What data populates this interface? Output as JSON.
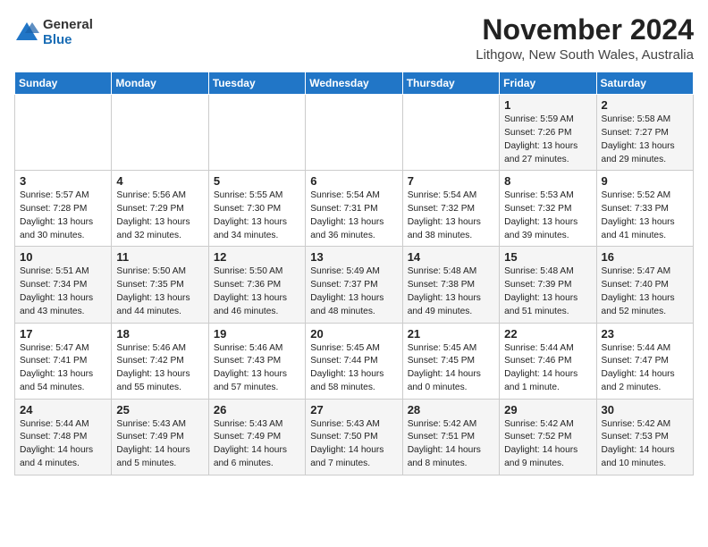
{
  "logo": {
    "general": "General",
    "blue": "Blue"
  },
  "title": "November 2024",
  "location": "Lithgow, New South Wales, Australia",
  "days_of_week": [
    "Sunday",
    "Monday",
    "Tuesday",
    "Wednesday",
    "Thursday",
    "Friday",
    "Saturday"
  ],
  "weeks": [
    [
      {
        "day": "",
        "info": ""
      },
      {
        "day": "",
        "info": ""
      },
      {
        "day": "",
        "info": ""
      },
      {
        "day": "",
        "info": ""
      },
      {
        "day": "",
        "info": ""
      },
      {
        "day": "1",
        "info": "Sunrise: 5:59 AM\nSunset: 7:26 PM\nDaylight: 13 hours\nand 27 minutes."
      },
      {
        "day": "2",
        "info": "Sunrise: 5:58 AM\nSunset: 7:27 PM\nDaylight: 13 hours\nand 29 minutes."
      }
    ],
    [
      {
        "day": "3",
        "info": "Sunrise: 5:57 AM\nSunset: 7:28 PM\nDaylight: 13 hours\nand 30 minutes."
      },
      {
        "day": "4",
        "info": "Sunrise: 5:56 AM\nSunset: 7:29 PM\nDaylight: 13 hours\nand 32 minutes."
      },
      {
        "day": "5",
        "info": "Sunrise: 5:55 AM\nSunset: 7:30 PM\nDaylight: 13 hours\nand 34 minutes."
      },
      {
        "day": "6",
        "info": "Sunrise: 5:54 AM\nSunset: 7:31 PM\nDaylight: 13 hours\nand 36 minutes."
      },
      {
        "day": "7",
        "info": "Sunrise: 5:54 AM\nSunset: 7:32 PM\nDaylight: 13 hours\nand 38 minutes."
      },
      {
        "day": "8",
        "info": "Sunrise: 5:53 AM\nSunset: 7:32 PM\nDaylight: 13 hours\nand 39 minutes."
      },
      {
        "day": "9",
        "info": "Sunrise: 5:52 AM\nSunset: 7:33 PM\nDaylight: 13 hours\nand 41 minutes."
      }
    ],
    [
      {
        "day": "10",
        "info": "Sunrise: 5:51 AM\nSunset: 7:34 PM\nDaylight: 13 hours\nand 43 minutes."
      },
      {
        "day": "11",
        "info": "Sunrise: 5:50 AM\nSunset: 7:35 PM\nDaylight: 13 hours\nand 44 minutes."
      },
      {
        "day": "12",
        "info": "Sunrise: 5:50 AM\nSunset: 7:36 PM\nDaylight: 13 hours\nand 46 minutes."
      },
      {
        "day": "13",
        "info": "Sunrise: 5:49 AM\nSunset: 7:37 PM\nDaylight: 13 hours\nand 48 minutes."
      },
      {
        "day": "14",
        "info": "Sunrise: 5:48 AM\nSunset: 7:38 PM\nDaylight: 13 hours\nand 49 minutes."
      },
      {
        "day": "15",
        "info": "Sunrise: 5:48 AM\nSunset: 7:39 PM\nDaylight: 13 hours\nand 51 minutes."
      },
      {
        "day": "16",
        "info": "Sunrise: 5:47 AM\nSunset: 7:40 PM\nDaylight: 13 hours\nand 52 minutes."
      }
    ],
    [
      {
        "day": "17",
        "info": "Sunrise: 5:47 AM\nSunset: 7:41 PM\nDaylight: 13 hours\nand 54 minutes."
      },
      {
        "day": "18",
        "info": "Sunrise: 5:46 AM\nSunset: 7:42 PM\nDaylight: 13 hours\nand 55 minutes."
      },
      {
        "day": "19",
        "info": "Sunrise: 5:46 AM\nSunset: 7:43 PM\nDaylight: 13 hours\nand 57 minutes."
      },
      {
        "day": "20",
        "info": "Sunrise: 5:45 AM\nSunset: 7:44 PM\nDaylight: 13 hours\nand 58 minutes."
      },
      {
        "day": "21",
        "info": "Sunrise: 5:45 AM\nSunset: 7:45 PM\nDaylight: 14 hours\nand 0 minutes."
      },
      {
        "day": "22",
        "info": "Sunrise: 5:44 AM\nSunset: 7:46 PM\nDaylight: 14 hours\nand 1 minute."
      },
      {
        "day": "23",
        "info": "Sunrise: 5:44 AM\nSunset: 7:47 PM\nDaylight: 14 hours\nand 2 minutes."
      }
    ],
    [
      {
        "day": "24",
        "info": "Sunrise: 5:44 AM\nSunset: 7:48 PM\nDaylight: 14 hours\nand 4 minutes."
      },
      {
        "day": "25",
        "info": "Sunrise: 5:43 AM\nSunset: 7:49 PM\nDaylight: 14 hours\nand 5 minutes."
      },
      {
        "day": "26",
        "info": "Sunrise: 5:43 AM\nSunset: 7:49 PM\nDaylight: 14 hours\nand 6 minutes."
      },
      {
        "day": "27",
        "info": "Sunrise: 5:43 AM\nSunset: 7:50 PM\nDaylight: 14 hours\nand 7 minutes."
      },
      {
        "day": "28",
        "info": "Sunrise: 5:42 AM\nSunset: 7:51 PM\nDaylight: 14 hours\nand 8 minutes."
      },
      {
        "day": "29",
        "info": "Sunrise: 5:42 AM\nSunset: 7:52 PM\nDaylight: 14 hours\nand 9 minutes."
      },
      {
        "day": "30",
        "info": "Sunrise: 5:42 AM\nSunset: 7:53 PM\nDaylight: 14 hours\nand 10 minutes."
      }
    ]
  ]
}
